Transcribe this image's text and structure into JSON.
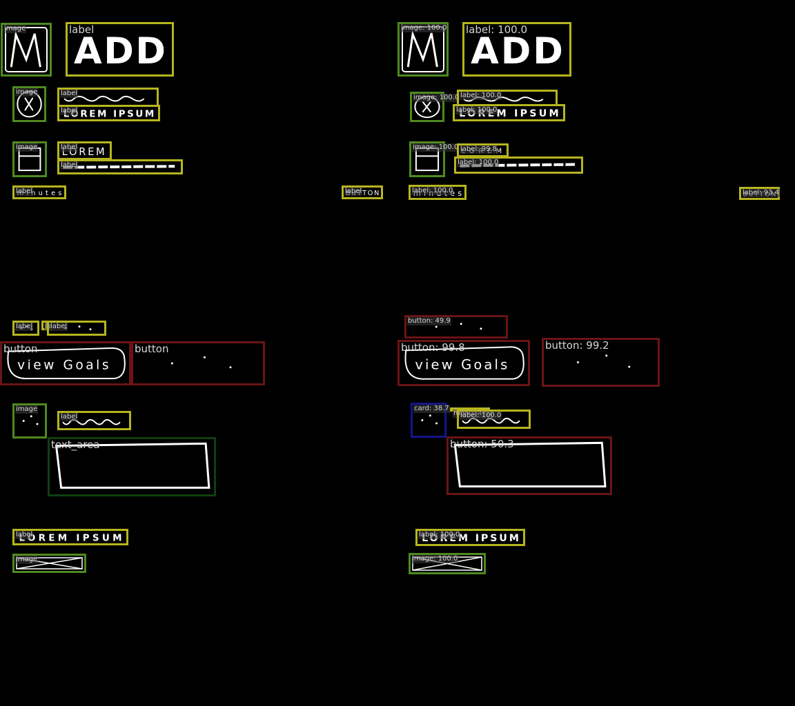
{
  "panels": [
    {
      "id": "left",
      "title": "",
      "elements": [
        {
          "kind": "image",
          "tag": "image",
          "big": false,
          "sketch": "m-icon"
        },
        {
          "kind": "label",
          "tag": "label",
          "big": true,
          "sketch": "add-text"
        },
        {
          "kind": "image",
          "tag": "image",
          "big": false,
          "sketch": "x-circle"
        },
        {
          "kind": "label",
          "tag": "label",
          "big": false,
          "sketch": "wave"
        },
        {
          "kind": "label",
          "tag": "label",
          "big": false,
          "sketch": "lorem-ipsum"
        },
        {
          "kind": "image",
          "tag": "image",
          "big": false,
          "sketch": "box-icon"
        },
        {
          "kind": "label",
          "tag": "label",
          "big": false,
          "sketch": "lorem"
        },
        {
          "kind": "label",
          "tag": "label",
          "big": false,
          "sketch": "dash-line"
        },
        {
          "kind": "label",
          "tag": "label",
          "big": false,
          "sketch": "minutes"
        },
        {
          "kind": "label",
          "tag": "label",
          "big": false,
          "sketch": "button-text"
        },
        {
          "kind": "label",
          "tag": "label",
          "big": false,
          "sketch": "dots"
        },
        {
          "kind": "label",
          "tag": "la",
          "big": false,
          "sketch": "none"
        },
        {
          "kind": "label",
          "tag": "label",
          "big": false,
          "sketch": "dots"
        },
        {
          "kind": "button",
          "tag": "button",
          "big": true,
          "sketch": "view-goals"
        },
        {
          "kind": "button",
          "tag": "button",
          "big": true,
          "sketch": "dots"
        },
        {
          "kind": "image",
          "tag": "image",
          "big": false,
          "sketch": "dots"
        },
        {
          "kind": "label",
          "tag": "label",
          "big": false,
          "sketch": "wave"
        },
        {
          "kind": "text_area",
          "tag": "text_area",
          "big": true,
          "sketch": "rect"
        },
        {
          "kind": "label",
          "tag": "label",
          "big": false,
          "sketch": "lorem-ipsum"
        },
        {
          "kind": "image",
          "tag": "image",
          "big": false,
          "sketch": "x-rect"
        }
      ]
    },
    {
      "id": "right",
      "title": "",
      "elements": [
        {
          "kind": "image",
          "tag": "image: 100.0",
          "big": false,
          "sketch": "m-icon"
        },
        {
          "kind": "label",
          "tag": "label: 100.0",
          "big": true,
          "sketch": "add-text"
        },
        {
          "kind": "image",
          "tag": "image: 100.0",
          "big": false,
          "sketch": "x-circle"
        },
        {
          "kind": "label",
          "tag": "label: 100.0",
          "big": false,
          "sketch": "wave"
        },
        {
          "kind": "label",
          "tag": "label: 100.0",
          "big": false,
          "sketch": "lorem-ipsum"
        },
        {
          "kind": "image",
          "tag": "image: 100.0",
          "big": false,
          "sketch": "box-icon"
        },
        {
          "kind": "label",
          "tag": "label: 99.8",
          "big": false,
          "sketch": "lorem"
        },
        {
          "kind": "label",
          "tag": "label: 100.0",
          "big": false,
          "sketch": "dash-line"
        },
        {
          "kind": "label",
          "tag": "label: 100.0",
          "big": false,
          "sketch": "minutes"
        },
        {
          "kind": "label",
          "tag": "label: 93.4",
          "big": false,
          "sketch": "button-text"
        },
        {
          "kind": "button",
          "tag": "button: 49.9",
          "big": false,
          "sketch": "dots"
        },
        {
          "kind": "button",
          "tag": "button: 99.8",
          "big": true,
          "sketch": "view-goals"
        },
        {
          "kind": "button",
          "tag": "button: 99.2",
          "big": true,
          "sketch": "dots"
        },
        {
          "kind": "card",
          "tag": "card: 38.7",
          "big": false,
          "sketch": "dots"
        },
        {
          "kind": "menu",
          "tag": "menu: 47.1",
          "big": false,
          "sketch": "none"
        },
        {
          "kind": "label",
          "tag": "label: 100.0",
          "big": false,
          "sketch": "wave"
        },
        {
          "kind": "button",
          "tag": "button: 50.3",
          "big": true,
          "sketch": "rect"
        },
        {
          "kind": "label",
          "tag": "label: 100.0",
          "big": false,
          "sketch": "lorem-ipsum"
        },
        {
          "kind": "image",
          "tag": "image: 100.0",
          "big": false,
          "sketch": "x-rect"
        }
      ]
    }
  ],
  "colors": {
    "image": "#4f8a1f",
    "label": "#b7b51f",
    "button": "#6b1414",
    "text_area": "#0f3f0f",
    "card": "#14148a",
    "menu": "#b7b51f"
  }
}
